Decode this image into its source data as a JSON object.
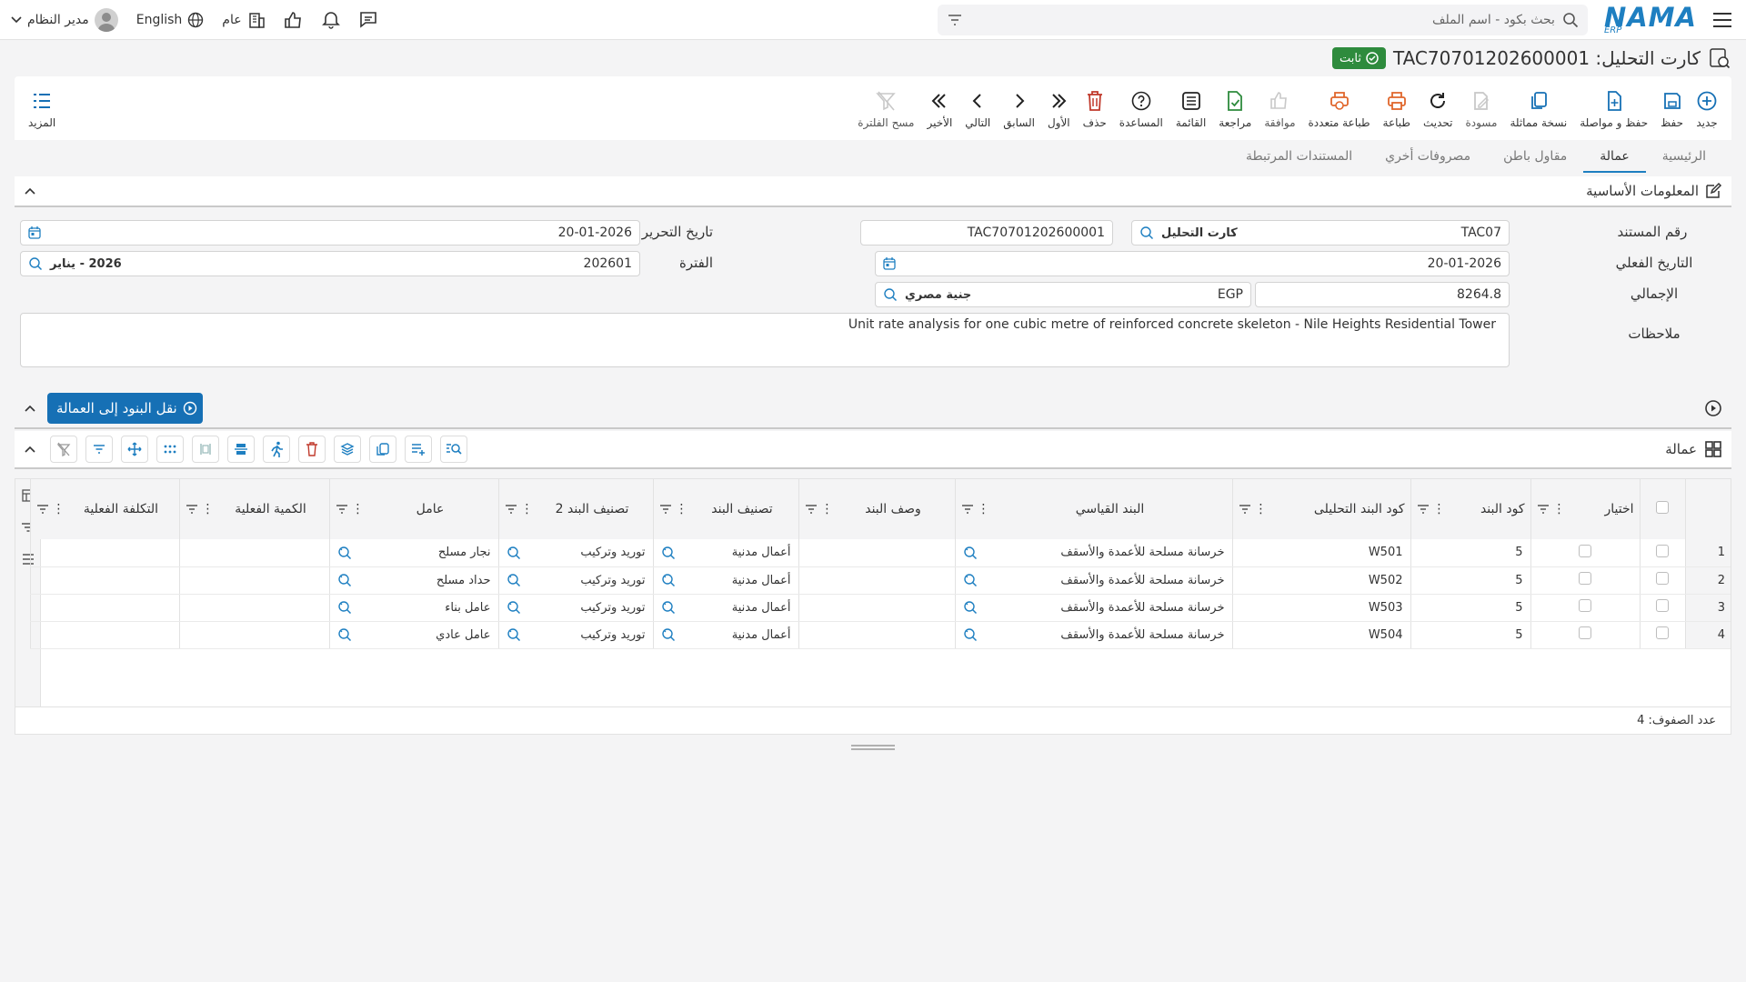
{
  "topbar": {
    "search_placeholder": "بحث بكود - اسم الملف",
    "user_name": "مدير النظام",
    "language": "English",
    "scope": "عام",
    "logo_text": "NAMA",
    "logo_sub": "ERP"
  },
  "page": {
    "title": "كارت التحليل: TAC70701202600001",
    "status": "ثابت"
  },
  "toolbar": {
    "new": "جديد",
    "save": "حفظ",
    "save_continue": "حفظ و مواصلة",
    "copy_similar": "نسخة مماثلة",
    "draft": "مسودة",
    "refresh": "تحديث",
    "print": "طباعة",
    "multi_print": "طباعة متعددة",
    "approve": "موافقة",
    "review": "مراجعة",
    "list": "القائمة",
    "help": "المساعدة",
    "delete": "حذف",
    "first": "الأول",
    "previous": "السابق",
    "next": "التالي",
    "last": "الأخير",
    "clear_filter": "مسح الفلترة",
    "more": "المزيد"
  },
  "tabs": [
    "الرئيسية",
    "عمالة",
    "مقاول باطن",
    "مصروفات أخري",
    "المستندات المرتبطة"
  ],
  "basic_info": {
    "header": "المعلومات الأساسية",
    "doc_number_label": "رقم المستند",
    "doc_code": "TAC07",
    "doc_type": "كارت التحليل",
    "doc_number": "TAC70701202600001",
    "edit_date_label": "تاريخ التحرير",
    "edit_date": "20-01-2026",
    "actual_date_label": "التاريخ الفعلي",
    "actual_date": "20-01-2026",
    "period_label": "الفترة",
    "period_code": "202601",
    "period_name": "2026 - يناير",
    "total_label": "الإجمالي",
    "total": "8264.8",
    "currency_code": "EGP",
    "currency_name": "جنية مصري",
    "notes_label": "ملاحظات",
    "notes": "Unit rate analysis for one cubic metre of reinforced concrete skeleton - Nile Heights Residential Tower"
  },
  "transfer_button": "نقل البنود إلى العمالة",
  "grid": {
    "title": "عمالة",
    "columns": {
      "select": "اختيار",
      "item_code": "كود البند",
      "analytic_code": "كود البند التحليلى",
      "std_item": "البند القياسي",
      "item_desc": "وصف البند",
      "item_class": "تصنيف البند",
      "item_class2": "تصنيف البند 2",
      "worker": "عامل",
      "actual_qty": "الكمية الفعلية",
      "actual_cost": "التكلفة الفعلية"
    },
    "rows": [
      {
        "n": "1",
        "item_code": "5",
        "analytic_code": "W501",
        "std_item": "خرسانة مسلحة للأعمدة والأسقف",
        "item_desc": "",
        "item_class": "أعمال مدنية",
        "item_class2": "توريد وتركيب",
        "worker": "نجار مسلح",
        "actual_qty": "",
        "actual_cost": ""
      },
      {
        "n": "2",
        "item_code": "5",
        "analytic_code": "W502",
        "std_item": "خرسانة مسلحة للأعمدة والأسقف",
        "item_desc": "",
        "item_class": "أعمال مدنية",
        "item_class2": "توريد وتركيب",
        "worker": "حداد مسلح",
        "actual_qty": "",
        "actual_cost": ""
      },
      {
        "n": "3",
        "item_code": "5",
        "analytic_code": "W503",
        "std_item": "خرسانة مسلحة للأعمدة والأسقف",
        "item_desc": "",
        "item_class": "أعمال مدنية",
        "item_class2": "توريد وتركيب",
        "worker": "عامل بناء",
        "actual_qty": "",
        "actual_cost": ""
      },
      {
        "n": "4",
        "item_code": "5",
        "analytic_code": "W504",
        "std_item": "خرسانة مسلحة للأعمدة والأسقف",
        "item_desc": "",
        "item_class": "أعمال مدنية",
        "item_class2": "توريد وتركيب",
        "worker": "عامل عادي",
        "actual_qty": "",
        "actual_cost": ""
      }
    ],
    "row_count_label": "عدد الصفوف: 4"
  },
  "colors": {
    "primary": "#1670b5",
    "success": "#2e8b3d",
    "danger": "#c0392b",
    "orange": "#e0662b"
  }
}
